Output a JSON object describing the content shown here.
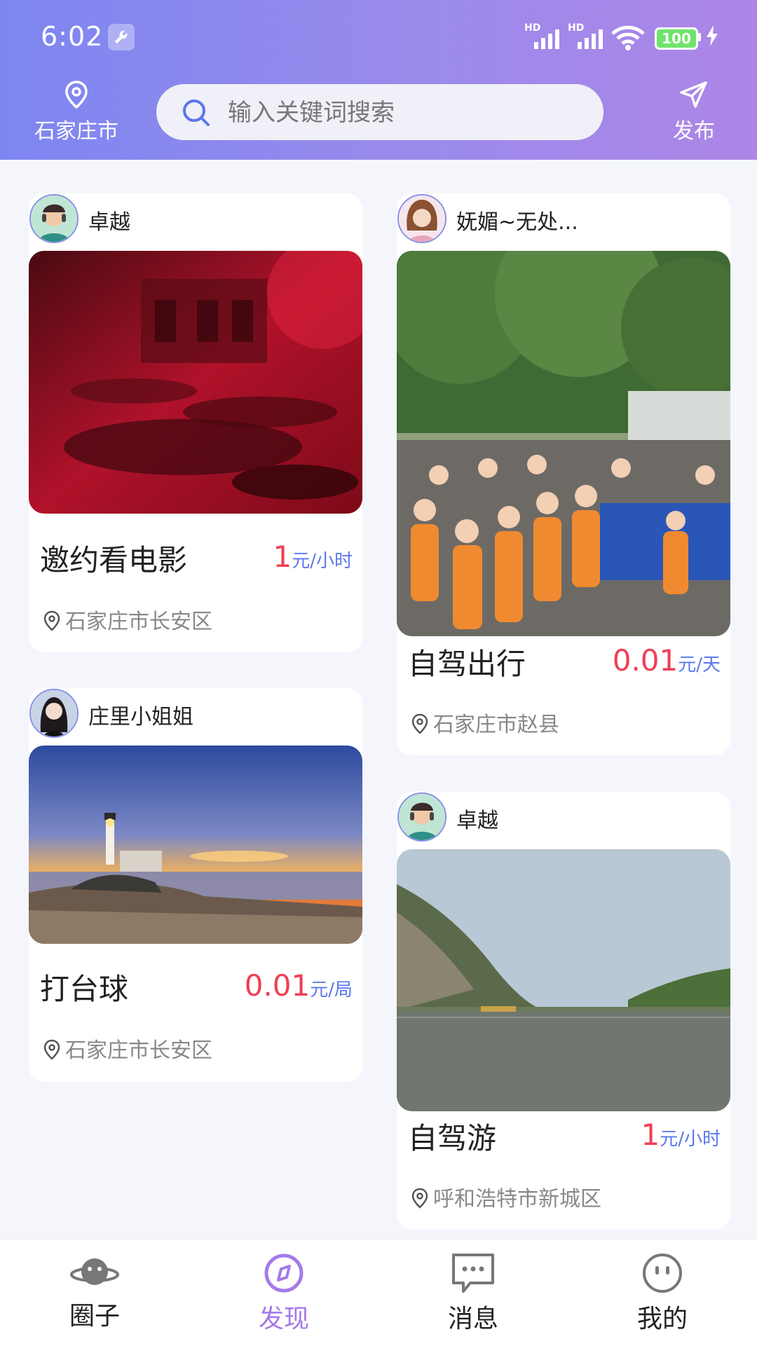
{
  "status_bar": {
    "time": "6:02",
    "battery": "100",
    "signal_tags": [
      "HD",
      "HD"
    ]
  },
  "header": {
    "city": "石家庄市",
    "search_placeholder": "输入关键词搜索",
    "publish_label": "发布"
  },
  "feed": [
    {
      "user": "卓越",
      "title": "邀约看电影",
      "price": "1",
      "unit": "元/小时",
      "location": "石家庄市长安区",
      "image": "red-lit-theater-scene"
    },
    {
      "user": "妩媚~无处...",
      "title": "自驾出行",
      "price": "0.01",
      "unit": "元/天",
      "location": "石家庄市赵县",
      "image": "crowd-of-children-in-orange"
    },
    {
      "user": "庄里小姐姐",
      "title": "打台球",
      "price": "0.01",
      "unit": "元/局",
      "location": "石家庄市长安区",
      "image": "lighthouse-sunset"
    },
    {
      "user": "卓越",
      "title": "自驾游",
      "price": "1",
      "unit": "元/小时",
      "location": "呼和浩特市新城区",
      "image": "river-gorge-landscape"
    }
  ],
  "tabbar": [
    {
      "label": "圈子",
      "icon": "planet-icon"
    },
    {
      "label": "发现",
      "icon": "compass-icon",
      "active": true
    },
    {
      "label": "消息",
      "icon": "message-icon"
    },
    {
      "label": "我的",
      "icon": "face-icon"
    }
  ],
  "colors": {
    "accent": "#a47ae8",
    "price": "#ef3f55",
    "unit": "#5b78ea"
  }
}
